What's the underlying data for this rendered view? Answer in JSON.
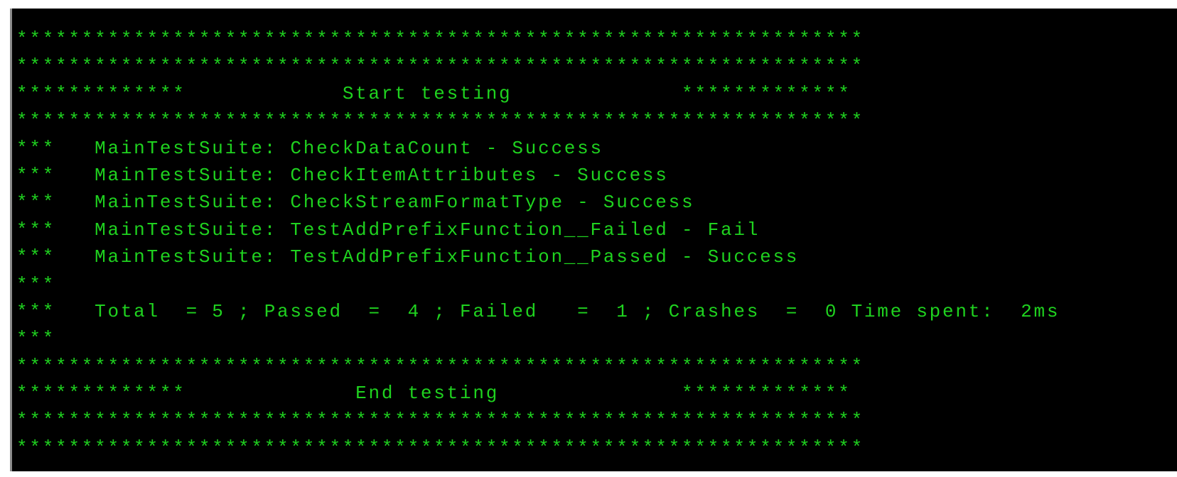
{
  "terminal": {
    "text_color": "#1fd21f",
    "background_color": "#000000",
    "lines": [
      "*****************************************************************",
      "*****************************************************************",
      "*************            Start testing             *************",
      "*****************************************************************",
      "***   MainTestSuite: CheckDataCount - Success",
      "***   MainTestSuite: CheckItemAttributes - Success",
      "***   MainTestSuite: CheckStreamFormatType - Success",
      "***   MainTestSuite: TestAddPrefixFunction__Failed - Fail",
      "***   MainTestSuite: TestAddPrefixFunction__Passed - Success",
      "***",
      "***   Total  = 5 ; Passed  =  4 ; Failed   =  1 ; Crashes  =  0 Time spent:  2ms",
      "***",
      "*****************************************************************",
      "*************             End testing              *************",
      "*****************************************************************",
      "*****************************************************************"
    ]
  }
}
